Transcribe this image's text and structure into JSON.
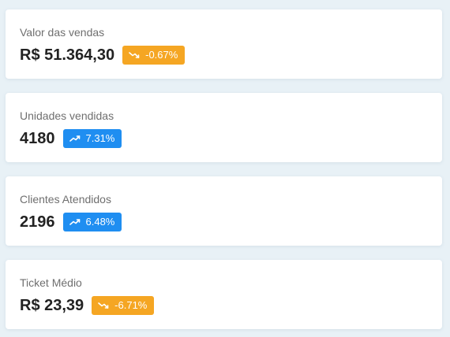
{
  "colors": {
    "page_background": "#e8f1f6",
    "card_background": "#ffffff",
    "trend_up": "#1f8ef1",
    "trend_down": "#f5a623"
  },
  "cards": [
    {
      "label": "Valor das vendas",
      "value": "R$ 51.364,30",
      "change": "-0.67%",
      "trend": "down",
      "trend_icon": "trending-down-icon"
    },
    {
      "label": "Unidades vendidas",
      "value": "4180",
      "change": "7.31%",
      "trend": "up",
      "trend_icon": "trending-up-icon"
    },
    {
      "label": "Clientes Atendidos",
      "value": "2196",
      "change": "6.48%",
      "trend": "up",
      "trend_icon": "trending-up-icon"
    },
    {
      "label": "Ticket Médio",
      "value": "R$ 23,39",
      "change": "-6.71%",
      "trend": "down",
      "trend_icon": "trending-down-icon"
    }
  ]
}
